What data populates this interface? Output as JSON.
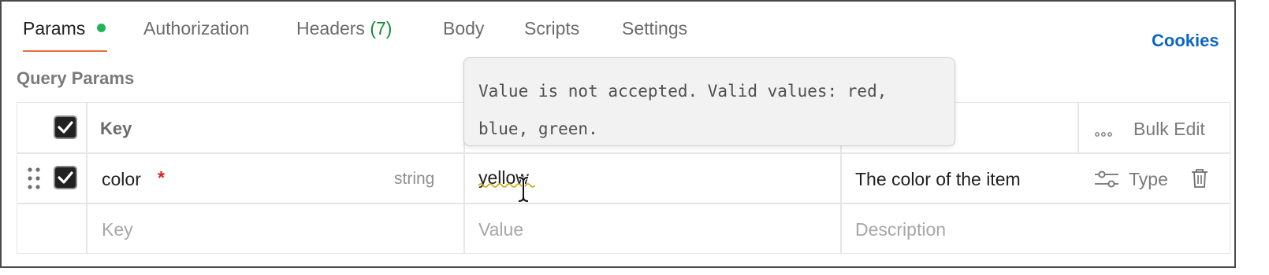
{
  "tabs": {
    "params": "Params",
    "authorization": "Authorization",
    "headers": "Headers",
    "headers_count": "(7)",
    "body": "Body",
    "scripts": "Scripts",
    "settings": "Settings",
    "cookies": "Cookies"
  },
  "section_title": "Query Params",
  "table": {
    "header": {
      "key": "Key",
      "bulk_edit": "Bulk Edit"
    },
    "row": {
      "key": "color",
      "required_marker": "*",
      "type_hint": "string",
      "value": "yellow",
      "description": "The color of the item",
      "type_button": "Type"
    },
    "new_row": {
      "key_placeholder": "Key",
      "value_placeholder": "Value",
      "description_placeholder": "Description"
    }
  },
  "tooltip": {
    "text": "Value is not accepted. Valid values: red, blue, green."
  },
  "colors": {
    "active_tab_underline": "#e4703c",
    "status_dot": "#1fb45a",
    "headers_count": "#138a36",
    "link": "#0c66c2",
    "required": "#d92020",
    "checkbox": "#212121",
    "validation_squiggle": "#c9a800"
  },
  "icons": {
    "drag": "drag-handle-icon",
    "check": "checkmark-icon",
    "more": "more-horizontal-icon",
    "type": "sliders-icon",
    "delete": "trash-icon",
    "cursor": "text-cursor-icon"
  }
}
